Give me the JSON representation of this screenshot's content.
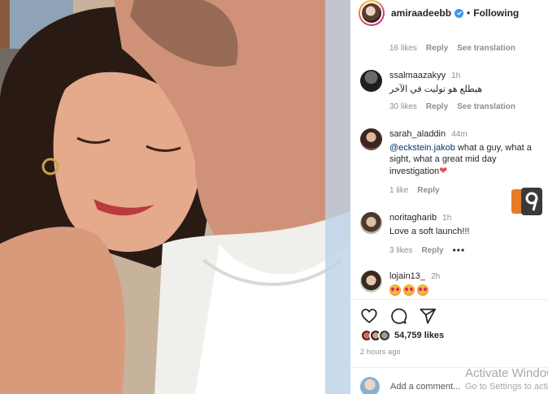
{
  "post": {
    "username": "amiraadeebb",
    "verified": true,
    "separator": "•",
    "follow_state": "Following"
  },
  "top_comment_partial": {
    "meta": {
      "likes": "16 likes",
      "reply": "Reply",
      "see_translation": "See translation"
    }
  },
  "comments": [
    {
      "username": "ssalmaazakyy",
      "time": "1h",
      "text": "هيطلع هو توليت في الآخر",
      "likes": "30 likes",
      "reply": "Reply",
      "see_translation": "See translation"
    },
    {
      "username": "sarah_aladdin",
      "time": "44m",
      "mention": "@eckstein.jakob",
      "text": " what a guy, what a sight, what a great mid day investigation",
      "heart": "❤",
      "likes": "1 like",
      "reply": "Reply"
    },
    {
      "username": "noritagharib",
      "time": "1h",
      "text": "Love a soft launch!!!",
      "likes": "3 likes",
      "reply": "Reply",
      "more": "•••"
    },
    {
      "username": "lojain13_",
      "time": "2h",
      "emoji_count": 3
    }
  ],
  "actions": {
    "like_icon": "heart-outline-icon",
    "comment_icon": "comment-bubble-icon",
    "share_icon": "paper-plane-icon"
  },
  "likes_summary": "54,759 likes",
  "posted_ago": "2 hours ago",
  "add_comment": {
    "placeholder": "Add a comment..."
  },
  "watermark": {
    "activate_title": "Activate Windows",
    "activate_sub": "Go to Settings to activate Windows."
  },
  "colors": {
    "link": "#00376b",
    "verified": "#3897f0",
    "heart": "#ed4956",
    "muted": "#8e8e8e"
  }
}
